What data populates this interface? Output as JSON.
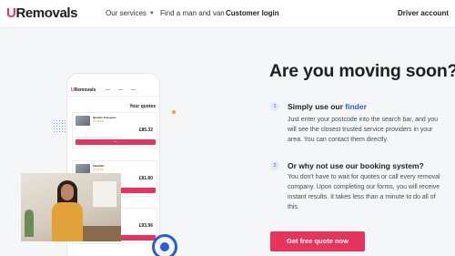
{
  "nav": {
    "logo_u": "U",
    "logo_rest": "Removals",
    "our_services": "Our services",
    "find_man_van": "Find a man and van",
    "customer_login": "Customer login",
    "driver_account": "Driver account"
  },
  "hero": {
    "headline": "Are you moving soon?",
    "steps": [
      {
        "number": "1",
        "title_prefix": "Simply use our ",
        "title_link": "finder",
        "text": "Just enter your postcode into the search bar, and you will see the closest trusted service providers in your area. You can contact them directly."
      },
      {
        "number": "2",
        "title": "Or why not use our booking system?",
        "text": "You don't have to wait for quotes or call every removal company. Upon completing our forms, you will receive instant results. It takes less than a minute to do all of this."
      }
    ],
    "cta_label": "Get free quote now"
  },
  "phone": {
    "logo_u": "U",
    "logo_rest": "Removals",
    "quotes_title": "Your quotes",
    "cards": [
      {
        "name": "Quattro Transport",
        "stars": "★★★★★",
        "price": "£85.32"
      },
      {
        "name": "FleetVan",
        "stars": "★★★★★",
        "price": "£81.80"
      },
      {
        "name": "",
        "stars": "★★★★★",
        "price": "£93.96"
      }
    ]
  },
  "icons": {
    "services_dropdown": "chevron-down-icon"
  },
  "colors": {
    "accent": "#e7345e",
    "link": "#2d5bd7"
  }
}
